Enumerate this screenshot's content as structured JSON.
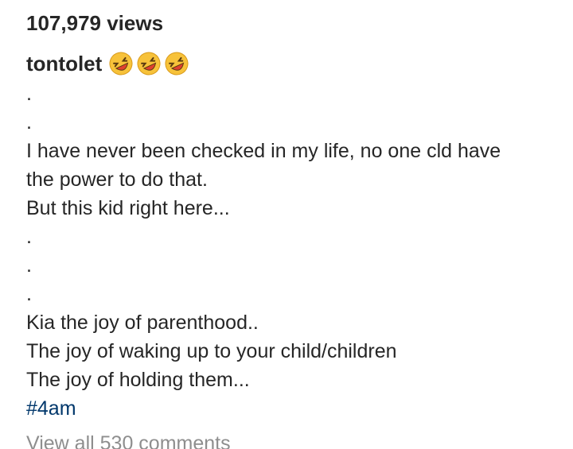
{
  "post": {
    "views": "107,979 views",
    "username": "tontolet",
    "emojis": [
      "rolling-on-floor-laughing-icon",
      "rolling-on-floor-laughing-icon",
      "rolling-on-floor-laughing-icon"
    ],
    "caption_lines": [
      ".",
      ".",
      "I have never been checked in my life, no one cld have",
      "the power to do that.",
      "But this kid right here...",
      ".",
      ".",
      ".",
      "Kia the joy of parenthood..",
      "The joy of waking up to your child/children",
      "The joy of holding them..."
    ],
    "hashtag": "#4am",
    "view_comments": "View all 530 comments"
  },
  "colors": {
    "text": "#262626",
    "hashtag": "#00376b",
    "muted": "#8e8e8e",
    "emoji_face": "#f7c23a",
    "emoji_mouth": "#e0402f"
  }
}
